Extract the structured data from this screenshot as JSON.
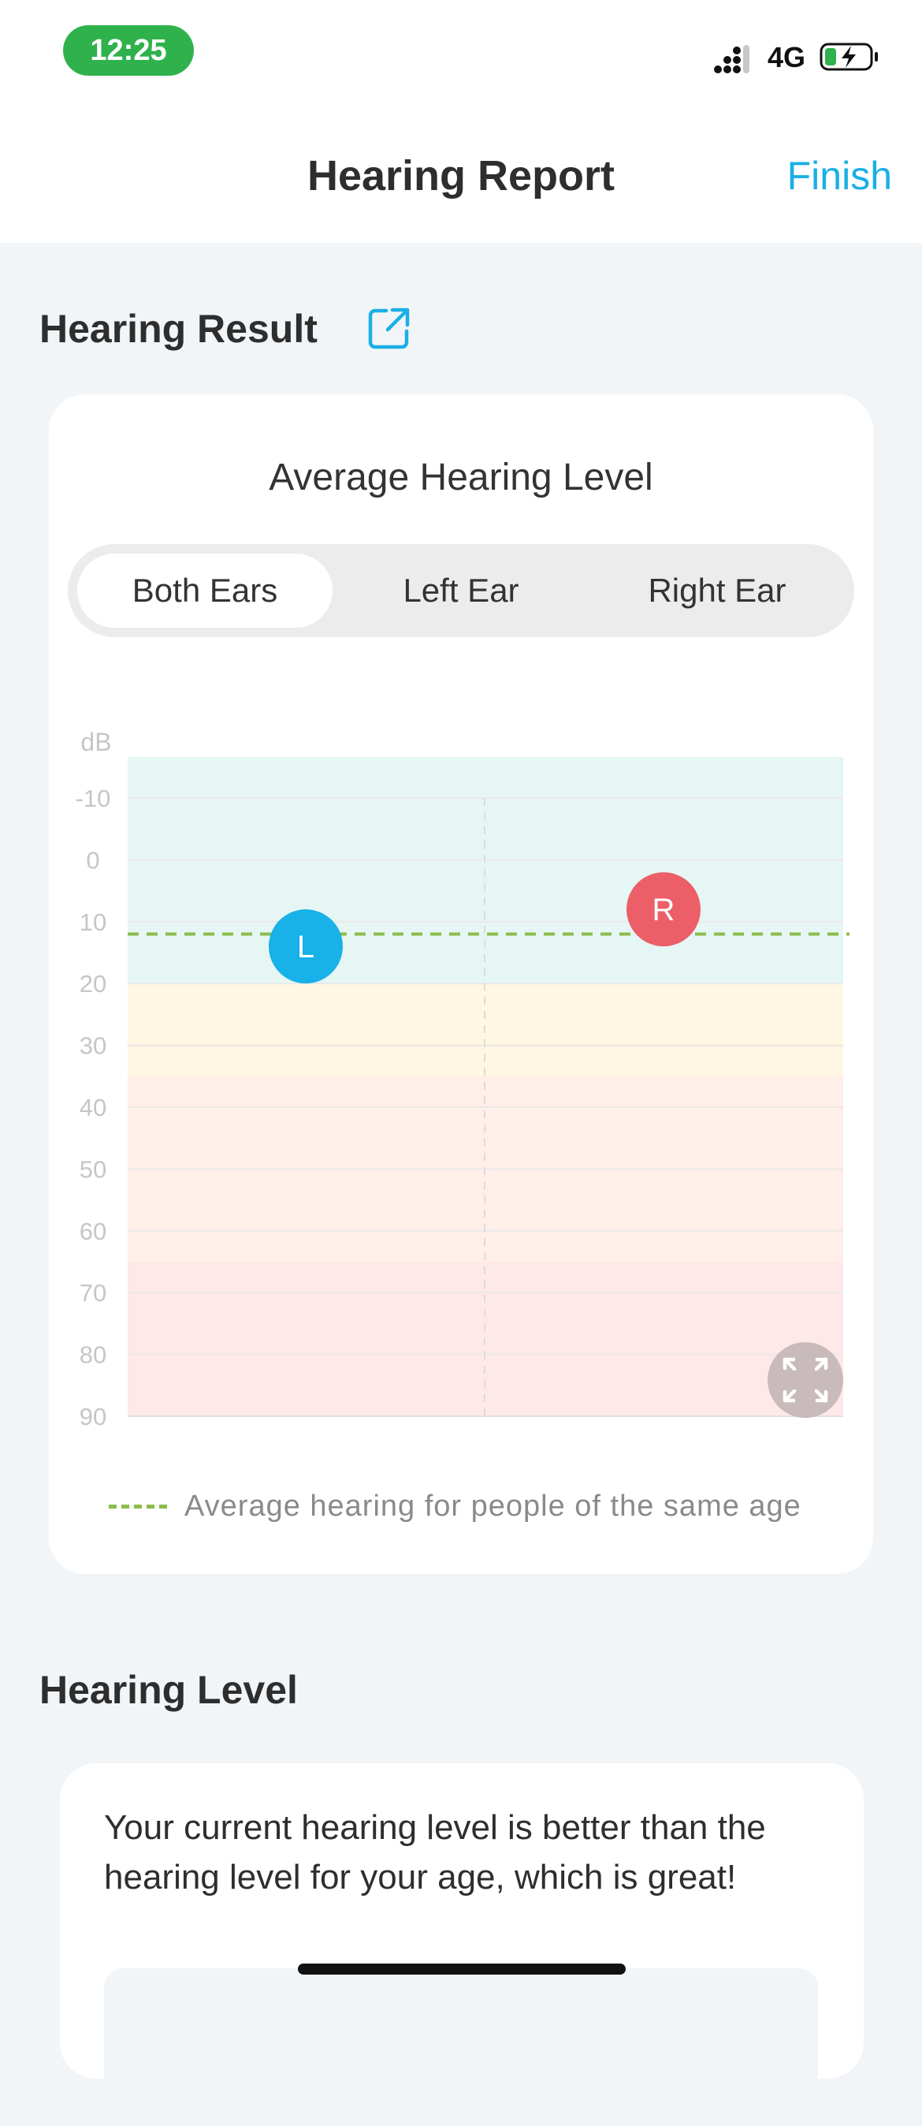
{
  "status_bar": {
    "time": "12:25",
    "network": "4G",
    "signal_icon": "cellular-signal-icon",
    "battery_icon": "battery-charging-icon"
  },
  "nav": {
    "title": "Hearing Report",
    "finish_label": "Finish",
    "accent_color": "#1aafe6"
  },
  "hearing_result": {
    "section_title": "Hearing Result",
    "share_icon": "share-external-icon",
    "card_title": "Average Hearing Level",
    "tabs": [
      {
        "label": "Both Ears",
        "selected": true
      },
      {
        "label": "Left Ear",
        "selected": false
      },
      {
        "label": "Right Ear",
        "selected": false
      }
    ],
    "legend_text": "Average hearing for people of the same age",
    "expand_icon": "expand-fullscreen-icon"
  },
  "chart_data": {
    "type": "scatter",
    "ylabel": "dB",
    "y_ticks": [
      "-10",
      "0",
      "10",
      "20",
      "30",
      "40",
      "50",
      "60",
      "70",
      "80",
      "90"
    ],
    "ylim": [
      -10,
      90
    ],
    "y_inverted": true,
    "bands": [
      {
        "from": -10,
        "to": 20,
        "color": "#e6f6f4"
      },
      {
        "from": 20,
        "to": 35,
        "color": "#fff7e2"
      },
      {
        "from": 35,
        "to": 65,
        "color": "#ffefe8"
      },
      {
        "from": 65,
        "to": 90,
        "color": "#ffe8e8"
      }
    ],
    "reference_line": {
      "value": 12,
      "color": "#8bbd4a",
      "style": "dashed"
    },
    "series": [
      {
        "marker": "L",
        "color": "#18b1e8",
        "value": 14
      },
      {
        "marker": "R",
        "color": "#ec5f68",
        "value": 8
      }
    ],
    "grid": true
  },
  "hearing_level": {
    "section_title": "Hearing Level",
    "message": "Your current hearing level is better than the hearing level for your age, which is great!"
  }
}
